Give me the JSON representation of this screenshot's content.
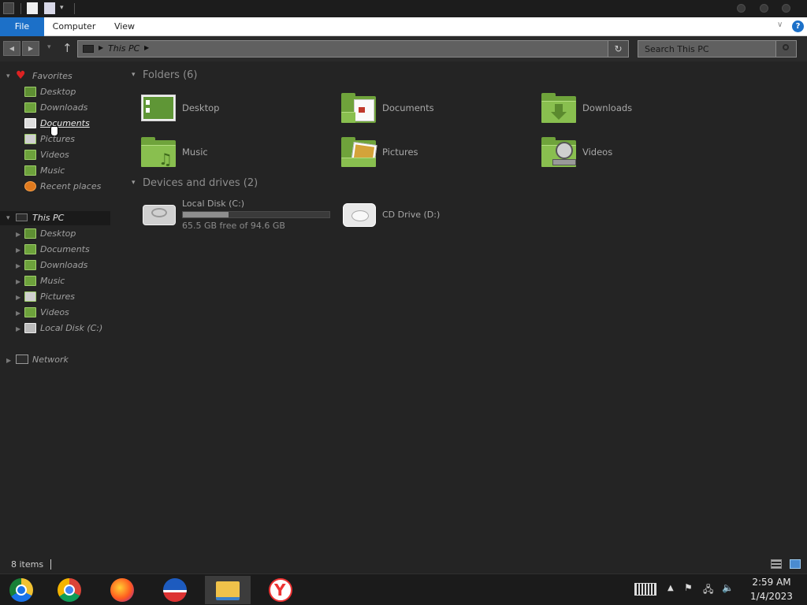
{
  "window": {
    "quick_access": [
      "app-menu-icon",
      "properties-icon",
      "new-folder-icon",
      "customize-chevron-icon"
    ]
  },
  "ribbon": {
    "tabs": [
      "File",
      "Computer",
      "View"
    ],
    "help": "?"
  },
  "address": {
    "path": "This PC",
    "search_placeholder": "Search This PC"
  },
  "nav": {
    "favorites": {
      "label": "Favorites",
      "items": [
        "Desktop",
        "Downloads",
        "Documents",
        "Pictures",
        "Videos",
        "Music",
        "Recent places"
      ]
    },
    "this_pc": {
      "label": "This PC",
      "items": [
        "Desktop",
        "Documents",
        "Downloads",
        "Music",
        "Pictures",
        "Videos",
        "Local Disk (C:)"
      ]
    },
    "network": {
      "label": "Network"
    }
  },
  "main": {
    "folders_header": "Folders (6)",
    "folders": [
      "Desktop",
      "Documents",
      "Downloads",
      "Music",
      "Pictures",
      "Videos"
    ],
    "devices_header": "Devices and drives (2)",
    "drives": [
      {
        "name": "Local Disk (C:)",
        "free": "65.5 GB free of 94.6 GB",
        "used_fraction": 0.31
      },
      {
        "name": "CD Drive (D:)"
      }
    ]
  },
  "status": {
    "items": "8 items"
  },
  "taskbar": {
    "apps": [
      "chrome-canary",
      "chrome",
      "firefox",
      "edge-like",
      "file-explorer",
      "yandex"
    ],
    "time": "2:59 AM",
    "date": "1/4/2023"
  },
  "colors": {
    "accent": "#1c70c8",
    "folder_green": "#89bf4f"
  }
}
